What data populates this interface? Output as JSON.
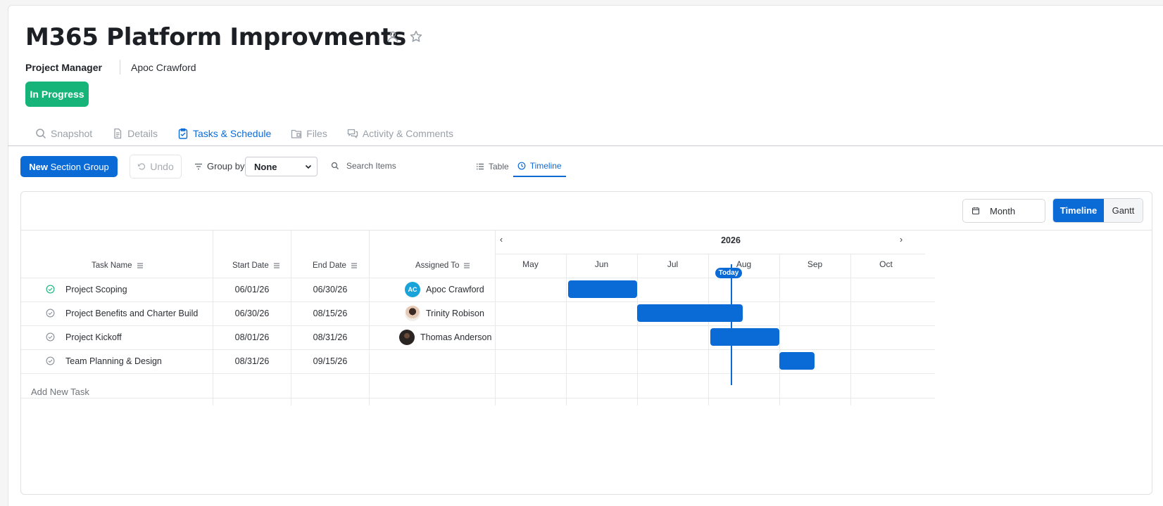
{
  "project": {
    "title": "M365 Platform Improvments",
    "manager_label": "Project Manager",
    "manager_name": "Apoc Crawford",
    "status": "In Progress"
  },
  "icons": {
    "follow": "person-icon",
    "favorite": "star-icon"
  },
  "tabs": [
    {
      "label": "Snapshot",
      "icon": "search-icon",
      "active": false
    },
    {
      "label": "Details",
      "icon": "document-icon",
      "active": false
    },
    {
      "label": "Tasks & Schedule",
      "icon": "clipboard-check-icon",
      "active": true
    },
    {
      "label": "Files",
      "icon": "folder-icon",
      "active": false
    },
    {
      "label": "Activity & Comments",
      "icon": "comments-icon",
      "active": false
    }
  ],
  "toolbar": {
    "new_bold": "New",
    "new_rest": " Section Group",
    "undo": "Undo",
    "group_by_label": "Group by",
    "group_by_value": "None",
    "search_placeholder": "Search Items",
    "view_table": "Table",
    "view_timeline": "Timeline"
  },
  "board": {
    "range_select": "Month",
    "seg_timeline": "Timeline",
    "seg_gantt": "Gantt",
    "columns": {
      "task": "Task Name",
      "start": "Start Date",
      "end": "End Date",
      "assigned": "Assigned To"
    },
    "add_task": "Add New Task",
    "year": "2026",
    "prev": "‹",
    "next": "›",
    "today": "Today",
    "today_date": "2026-08-05",
    "months": [
      "May",
      "Jun",
      "Jul",
      "Aug",
      "Sep",
      "Oct"
    ],
    "tasks": [
      {
        "name": "Project Scoping",
        "start": "06/01/26",
        "end": "06/30/26",
        "assignee": "Apoc Crawford",
        "initials": "AC",
        "avatar_color": "#1aa3d9",
        "done": true
      },
      {
        "name": "Project Benefits and Charter Build",
        "start": "06/30/26",
        "end": "08/15/26",
        "assignee": "Trinity Robison",
        "initials": "",
        "avatar_color": "#c9a48a",
        "done": false
      },
      {
        "name": "Project Kickoff",
        "start": "08/01/26",
        "end": "08/31/26",
        "assignee": "Thomas Anderson",
        "initials": "",
        "avatar_color": "#2a2422",
        "done": false
      },
      {
        "name": "Team Planning & Design",
        "start": "08/31/26",
        "end": "09/15/26",
        "assignee": "",
        "initials": "",
        "avatar_color": "",
        "done": false
      }
    ]
  },
  "colors": {
    "accent": "#0b6bd6",
    "status_green": "#17b47a",
    "check_done": "#17b47a",
    "check_pending": "#8a9099"
  }
}
